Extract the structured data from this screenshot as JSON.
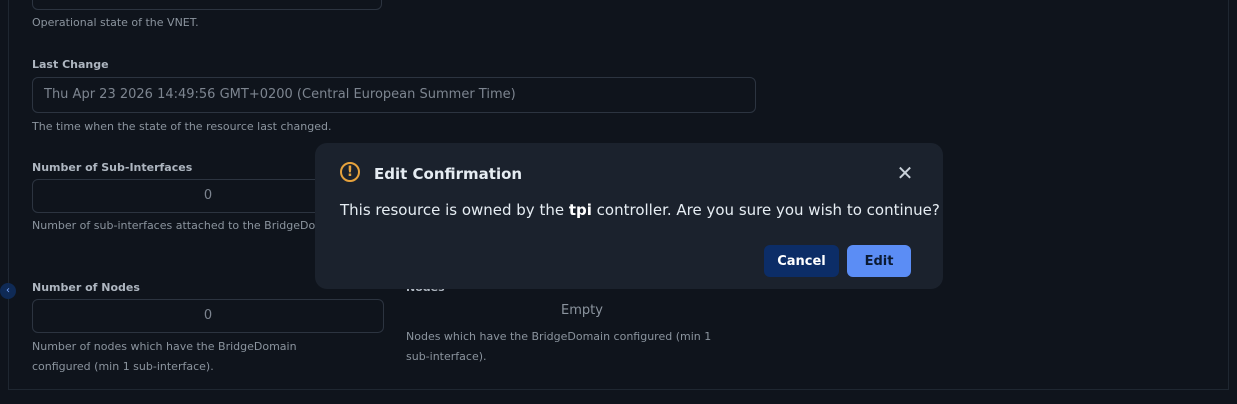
{
  "form": {
    "operational_state_help": "Operational state of the VNET.",
    "last_change": {
      "label": "Last Change",
      "value": "Thu Apr 23 2026 14:49:56 GMT+0200 (Central European Summer Time)",
      "help": "The time when the state of the resource last changed."
    },
    "sub_interfaces": {
      "label": "Number of Sub-Interfaces",
      "value": "0",
      "help": "Number of sub-interfaces attached to the BridgeDo"
    },
    "num_nodes": {
      "label": "Number of Nodes",
      "value": "0",
      "help_line1": "Number of nodes which have the BridgeDomain",
      "help_line2": "configured (min 1 sub-interface)."
    },
    "nodes": {
      "label": "Nodes",
      "empty_text": "Empty",
      "help_line1": "Nodes which have the BridgeDomain configured (min 1",
      "help_line2": "sub-interface)."
    }
  },
  "dialog": {
    "title": "Edit Confirmation",
    "warning_glyph": "!",
    "message_prefix": "This resource is owned by the ",
    "message_owner": "tpi",
    "message_suffix": " controller. Are you sure you wish to continue?",
    "cancel_label": "Cancel",
    "edit_label": "Edit",
    "close_glyph": "✕",
    "icons": {
      "warning": "warning-icon",
      "close": "close-icon"
    }
  },
  "colors": {
    "accent": "#5b8df5",
    "warning": "#e6a23c",
    "dialog_bg": "#1b222d",
    "page_bg": "#0f141c"
  }
}
